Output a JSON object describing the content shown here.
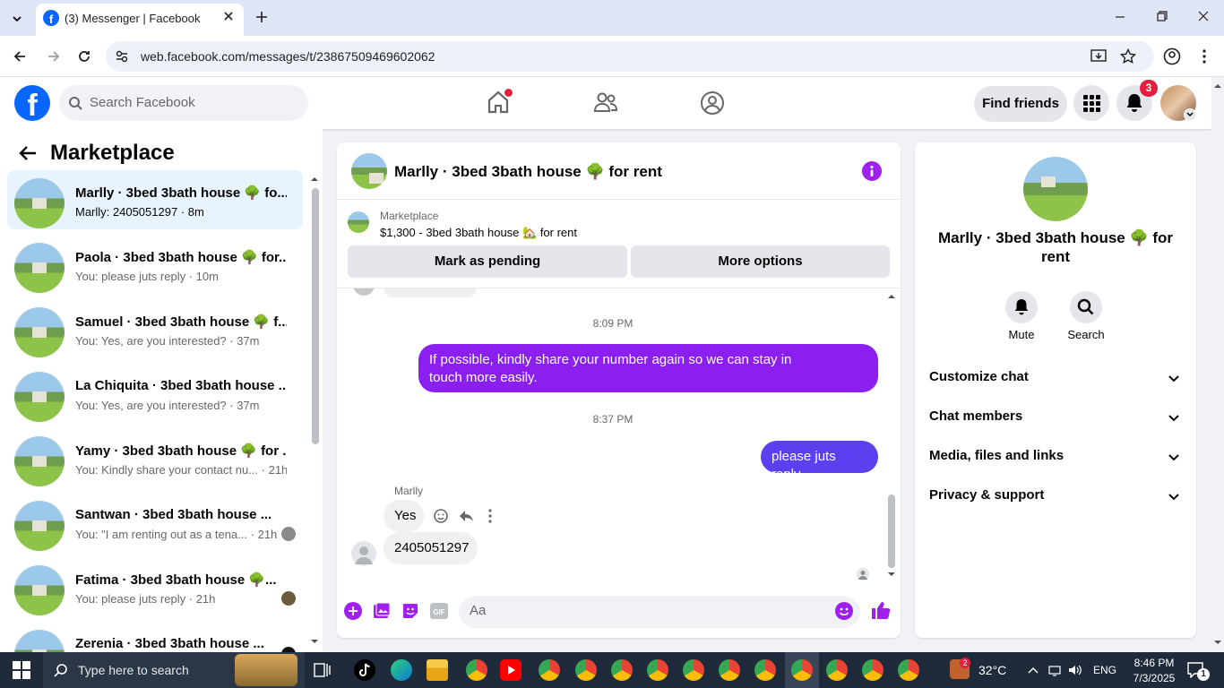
{
  "browser": {
    "tab_title": "(3) Messenger | Facebook",
    "url": "web.facebook.com/messages/t/23867509469602062"
  },
  "fb_header": {
    "logo": "f",
    "search_placeholder": "Search Facebook",
    "find_friends_label": "Find friends",
    "notifications_count": "3"
  },
  "sidebar": {
    "title": "Marketplace",
    "conversations": [
      {
        "name": "Marlly · 3bed 3bath house 🌳 fo...",
        "preview": "Marlly: 2405051297 · 8m"
      },
      {
        "name": "Paola · 3bed 3bath house 🌳 for...",
        "preview": "You: please juts reply · 10m"
      },
      {
        "name": "Samuel · 3bed 3bath house 🌳 f...",
        "preview": "You: Yes, are you interested? · 37m"
      },
      {
        "name": "La Chiquita · 3bed 3bath house ...",
        "preview": "You: Yes, are you interested? · 37m"
      },
      {
        "name": "Yamy · 3bed 3bath house 🌳 for ...",
        "preview": "You: Kindly share your contact nu... · 21h"
      },
      {
        "name": "Santwan · 3bed 3bath house ...",
        "preview": "You: \"I am renting out as a tena... · 21h"
      },
      {
        "name": "Fatima · 3bed 3bath house 🌳...",
        "preview": "You: please juts reply · 21h"
      },
      {
        "name": "Zerenia · 3bed 3bath house ...",
        "preview": ""
      }
    ]
  },
  "chat": {
    "title": "Marlly · 3bed 3bath house 🌳 for rent",
    "marketplace_label": "Marketplace",
    "listing": "$1,300 - 3bed 3bath house 🏡 for rent",
    "mark_pending_label": "Mark as pending",
    "more_options_label": "More options",
    "time1": "8:09 PM",
    "msg_out_1_line1": "If possible, kindly share your number again so we can stay in",
    "msg_out_1_line2": "touch more easily.",
    "time2": "8:37 PM",
    "msg_out_2": "please juts reply",
    "sender": "Marlly",
    "msg_in_1": "Yes",
    "msg_in_2": "2405051297",
    "input_placeholder": "Aa"
  },
  "info_panel": {
    "name": "Marlly · 3bed 3bath house 🌳 for rent",
    "mute_label": "Mute",
    "search_label": "Search",
    "rows": [
      "Customize chat",
      "Chat members",
      "Media, files and links",
      "Privacy & support"
    ]
  },
  "taskbar": {
    "search_placeholder": "Type here to search",
    "temperature": "32°C",
    "language": "ENG",
    "time": "8:46 PM",
    "date": "7/3/2025",
    "weather_badge": "2",
    "notification_count": "1"
  },
  "colors": {
    "fb_blue": "#0866ff",
    "outgoing_bubble": "#8a1ff0",
    "outgoing_bubble_2": "#5b3ff0",
    "accent_purple": "#a01ff0"
  }
}
